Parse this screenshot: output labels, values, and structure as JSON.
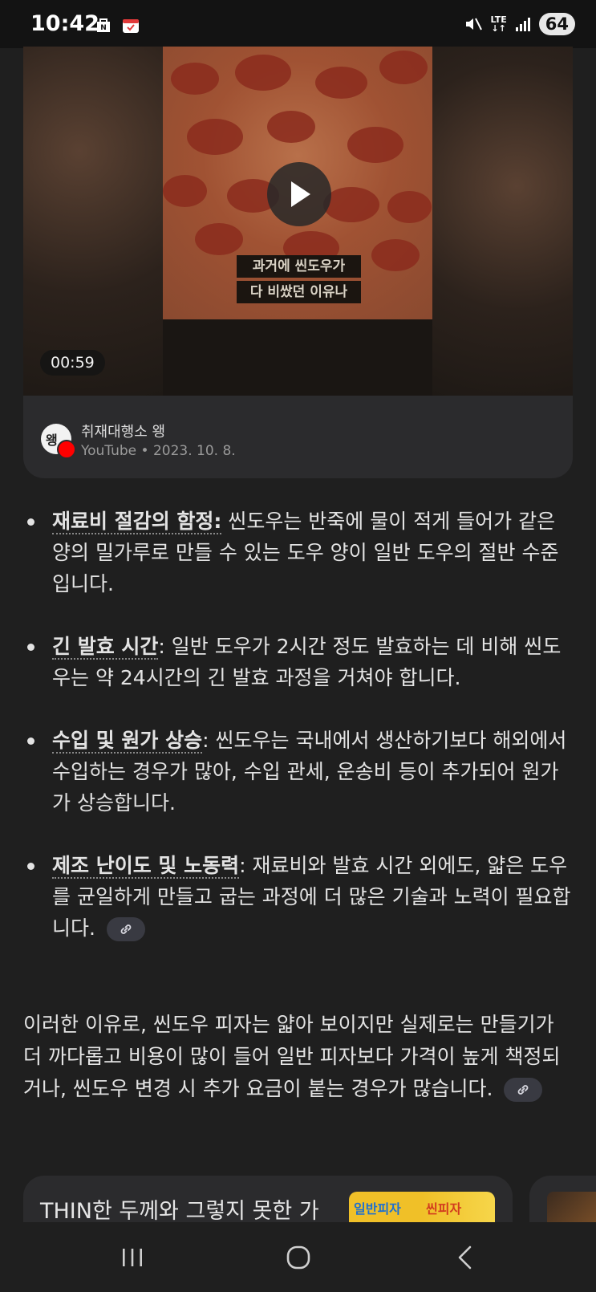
{
  "status_bar": {
    "time": "10:42",
    "network": "LTE",
    "battery": "64",
    "icons": [
      "notification-news-icon",
      "calendar-app-icon",
      "mute-icon",
      "signal-icon"
    ]
  },
  "video_card": {
    "duration": "00:59",
    "subtitle_line1": "과거에 씬도우가",
    "subtitle_line2": "다 비쌌던 이유나",
    "channel_name": "취재대행소 왱",
    "channel_meta": "YouTube • 2023. 10. 8.",
    "avatar_text": "왱"
  },
  "bullets": [
    {
      "term": "재료비 절감의 함정:",
      "text": " 씬도우는 반죽에 물이 적게 들어가 같은 양의 밀가루로 만들 수 있는 도우 양이 일반 도우의 절반 수준입니다.",
      "has_source": false
    },
    {
      "term": "긴 발효 시간",
      "text": ": 일반 도우가 2시간 정도 발효하는 데 비해 씬도우는 약 24시간의 긴 발효 과정을 거쳐야 합니다.",
      "has_source": false
    },
    {
      "term": "수입 및 원가 상승",
      "text": ": 씬도우는 국내에서 생산하기보다 해외에서 수입하는 경우가 많아, 수입 관세, 운송비 등이 추가되어 원가가 상승합니다.",
      "has_source": false
    },
    {
      "term": "제조 난이도 및 노동력",
      "text": ": 재료비와 발효 시간 외에도, 얇은 도우를 균일하게 만들고 굽는 과정에 더 많은 기술과 노력이 필요합니다.",
      "has_source": true
    }
  ],
  "summary": "이러한 이유로, 씬도우 피자는 얇아 보이지만 실제로는 만들기가 더 까다롭고 비용이 많이 들어 일반 피자보다 가격이 높게 책정되거나, 씬도우 변경 시 추가 요금이 붙는 경우가 많습니다.",
  "related_card": {
    "title": "THIN한 두께와 그렇지 못한 가",
    "thumb_left": "일반피자",
    "thumb_right": "씬피자"
  },
  "nav": {
    "recents": "recents-icon",
    "home": "home-icon",
    "back": "back-icon"
  }
}
